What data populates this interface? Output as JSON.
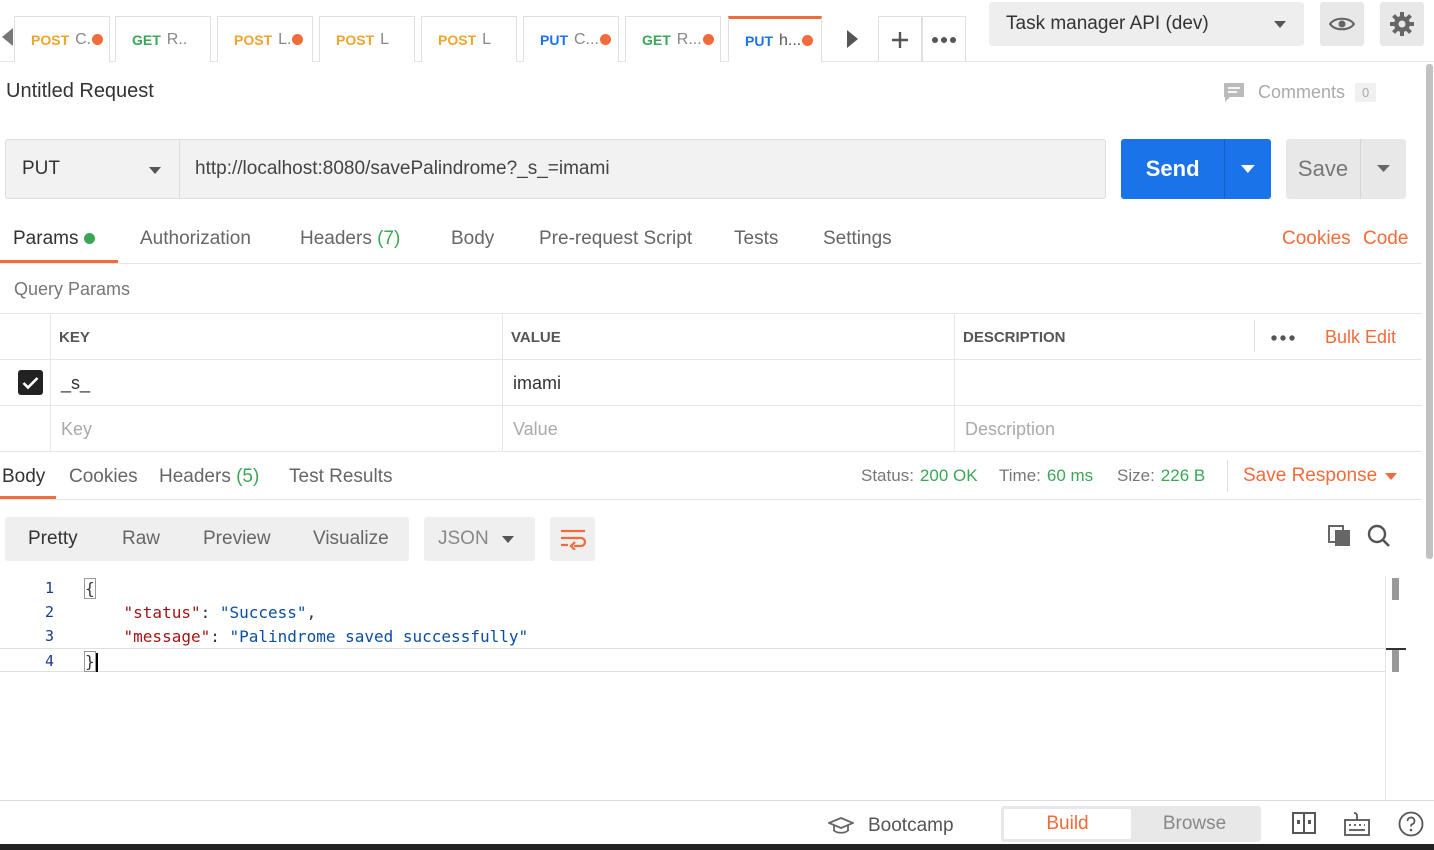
{
  "tabs": [
    {
      "method": "POST",
      "name": "C.",
      "unsaved": true
    },
    {
      "method": "GET",
      "name": "R..",
      "unsaved": false
    },
    {
      "method": "POST",
      "name": "L.",
      "unsaved": true
    },
    {
      "method": "POST",
      "name": "L",
      "unsaved": false
    },
    {
      "method": "POST",
      "name": "L",
      "unsaved": false
    },
    {
      "method": "PUT",
      "name": "C...",
      "unsaved": true
    },
    {
      "method": "GET",
      "name": "R...",
      "unsaved": true
    },
    {
      "method": "PUT",
      "name": "h...",
      "unsaved": true,
      "active": true
    }
  ],
  "environment": {
    "selected": "Task manager API (dev)"
  },
  "request": {
    "title": "Untitled Request",
    "comments_label": "Comments",
    "comments_count": "0",
    "method": "PUT",
    "url": "http://localhost:8080/savePalindrome?_s_=imami",
    "send_label": "Send",
    "save_label": "Save"
  },
  "request_tabs": {
    "params": "Params",
    "authorization": "Authorization",
    "headers": "Headers",
    "headers_count": "(7)",
    "body": "Body",
    "prerequest": "Pre-request Script",
    "tests": "Tests",
    "settings": "Settings",
    "cookies": "Cookies",
    "code": "Code"
  },
  "query_params": {
    "label": "Query Params",
    "columns": {
      "key": "KEY",
      "value": "VALUE",
      "description": "DESCRIPTION"
    },
    "bulk_edit": "Bulk Edit",
    "rows": [
      {
        "key": "_s_",
        "value": "imami",
        "description": "",
        "enabled": true
      }
    ],
    "placeholders": {
      "key": "Key",
      "value": "Value",
      "description": "Description"
    }
  },
  "response_tabs": {
    "body": "Body",
    "cookies": "Cookies",
    "headers": "Headers",
    "headers_count": "(5)",
    "test_results": "Test Results"
  },
  "response_status": {
    "status_label": "Status:",
    "status_value": "200 OK",
    "time_label": "Time:",
    "time_value": "60 ms",
    "size_label": "Size:",
    "size_value": "226 B",
    "save_response": "Save Response"
  },
  "view_modes": {
    "pretty": "Pretty",
    "raw": "Raw",
    "preview": "Preview",
    "visualize": "Visualize",
    "format": "JSON"
  },
  "response_body": {
    "line_numbers": [
      "1",
      "2",
      "3",
      "4"
    ],
    "open_brace": "{",
    "close_brace": "}",
    "status_key": "\"status\"",
    "status_value": "\"Success\"",
    "message_key": "\"message\"",
    "message_value": "\"Palindrome saved successfully\""
  },
  "statusbar": {
    "bootcamp": "Bootcamp",
    "build": "Build",
    "browse": "Browse"
  },
  "colors": {
    "accent": "#f26b3a",
    "send_blue": "#1a73e8",
    "success_green": "#3aa757",
    "post": "#f0a52c",
    "get": "#3aa757",
    "put": "#1a73e8"
  }
}
